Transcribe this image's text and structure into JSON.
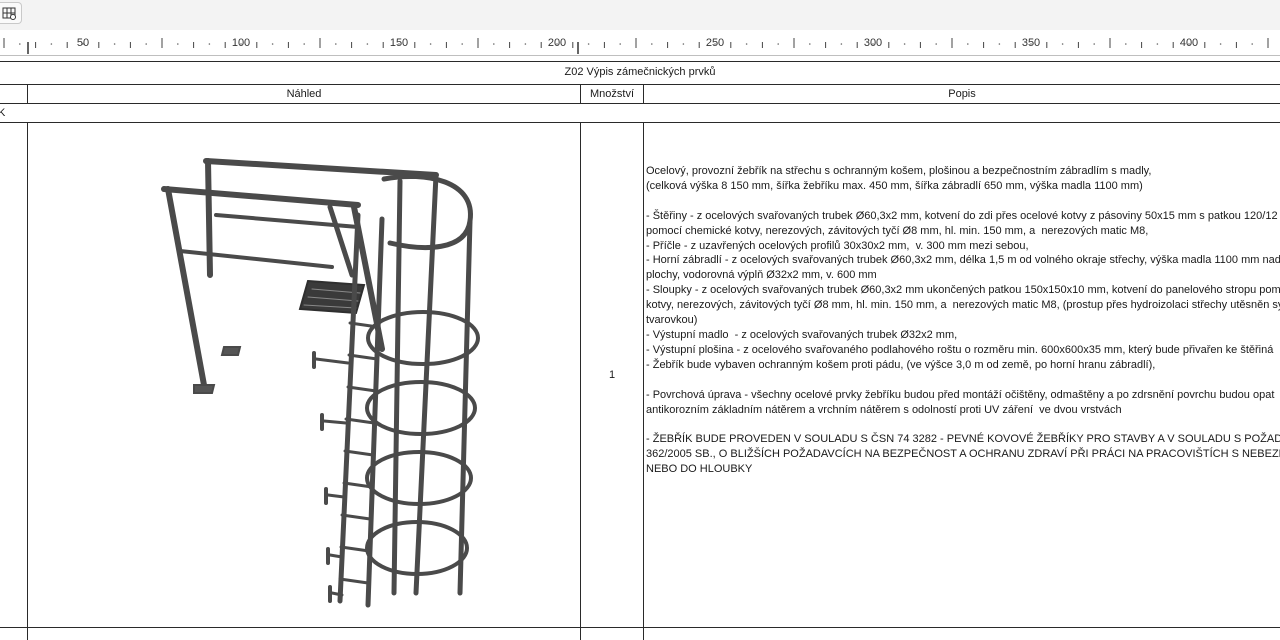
{
  "toolbar": {
    "tool_icon": "grid-tool-icon"
  },
  "ruler": {
    "labels": [
      "50",
      "100",
      "150",
      "200",
      "250",
      "300",
      "350",
      "400"
    ]
  },
  "table": {
    "title": "Z02 Výpis zámečnických prvků",
    "columns": {
      "preview": "Náhled",
      "quantity": "Množství",
      "description": "Popis"
    },
    "group_marker": "K",
    "rows": [
      {
        "quantity": "1",
        "preview_icon": "ladder-with-cage-drawing",
        "description_lines": [
          "Ocelový, provozní žebřík na střechu s ochranným košem, plošinou a bezpečnostním zábradlím s madly,",
          "(celková výška 8 150 mm, šířka žebříku max. 450 mm, šířka zábradlí 650 mm, výška madla 1100 mm)",
          "",
          "- Štěřiny - z ocelových svařovaných trubek Ø60,3x2 mm, kotvení do zdi přes ocelové kotvy z pásoviny 50x15 mm s patkou 120/12",
          "pomocí chemické kotvy, nerezových, závitových tyčí Ø8 mm, hl. min. 150 mm, a  nerezových matic M8,",
          "- Příčle - z uzavřených ocelových profilů 30x30x2 mm,  v. 300 mm mezi sebou,",
          "- Horní zábradlí - z ocelových svařovaných trubek Ø60,3x2 mm, délka 1,5 m od volného okraje střechy, výška madla 1100 mm nad",
          "plochy, vodorovná výplň Ø32x2 mm, v. 600 mm",
          "- Sloupky - z ocelových svařovaných trubek Ø60,3x2 mm ukončených patkou 150x150x10 mm, kotvení do panelového stropu pom",
          "kotvy, nerezových, závitových tyčí Ø8 mm, hl. min. 150 mm, a  nerezových matic M8, (prostup přes hydroizolaci střechy utěsněn sy",
          "tvarovkou)",
          "- Výstupní madlo  - z ocelových svařovaných trubek Ø32x2 mm,",
          "- Výstupní plošina - z ocelového svařovaného podlahového roštu o rozměru min. 600x600x35 mm, který bude přivařen ke štěřiná",
          "- Žebřík bude vybaven ochranným košem proti pádu, (ve výšce 3,0 m od země, po horní hranu zábradlí),",
          "",
          "- Povrchová úprava - všechny ocelové prvky žebříku budou před montáží očištěny, odmaštěny a po zdrsnění povrchu budou opat",
          "antikorozním základním nátěrem a vrchním nátěrem s odolností proti UV záření  ve dvou vrstvách",
          "",
          "- ŽEBŘÍK BUDE PROVEDEN V SOULADU S ČSN 74 3282 - PEVNÉ KOVOVÉ ŽEBŘÍKY PRO STAVBY A V SOULADU S POŽADAVKY NA",
          "362/2005 SB., O BLIŽŠÍCH POŽADAVCÍCH NA BEZPEČNOST A OCHRANU ZDRAVÍ PŘI PRÁCI NA PRACOVIŠTÍCH S NEBEZPEČÍM PÁ",
          "NEBO DO HLOUBKY"
        ]
      }
    ]
  }
}
